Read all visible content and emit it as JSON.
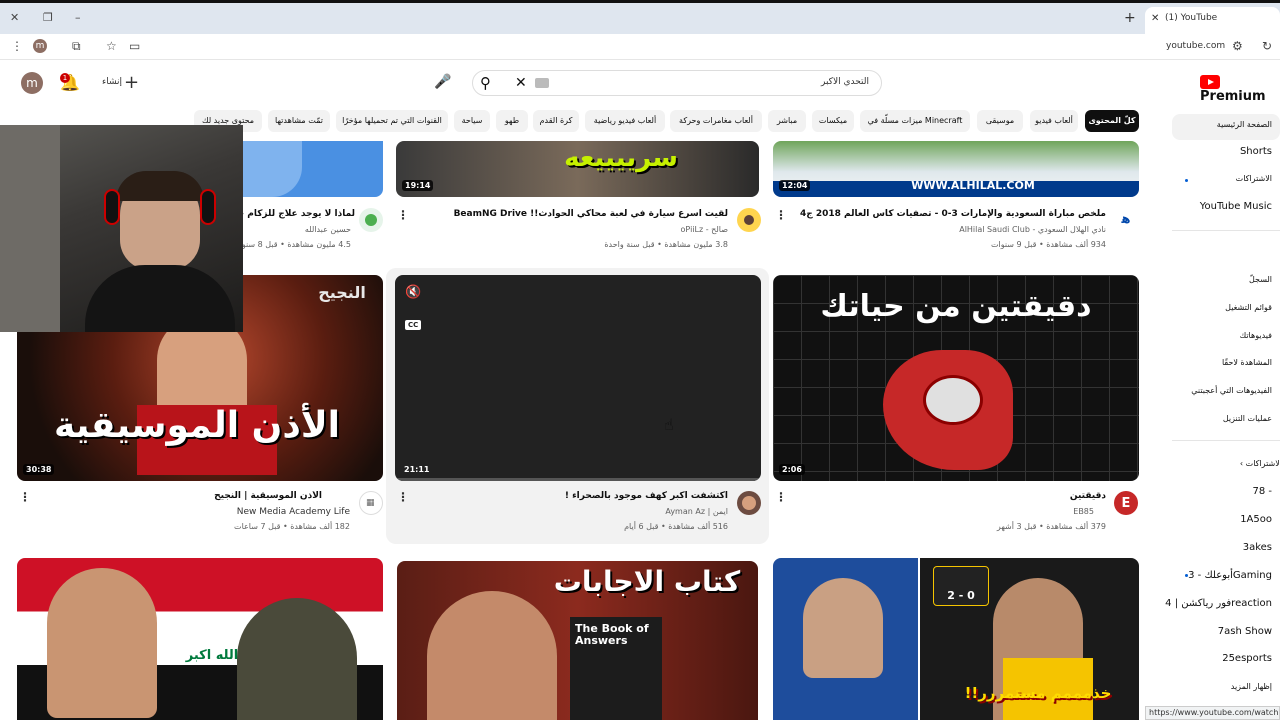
{
  "browser": {
    "tab_title": "(1) YouTube",
    "url": "youtube.com",
    "status_url": "https://www.youtube.com/watch?v"
  },
  "header": {
    "avatar_letter": "m",
    "notification_count": "1",
    "create_label": "إنشاء",
    "search_query": "التحدي الاكبر",
    "brand": "Premium"
  },
  "chips": [
    {
      "label": "كلّ المحتوى",
      "active": true
    },
    {
      "label": "ألعاب فيديو"
    },
    {
      "label": "موسيقى"
    },
    {
      "label": "ميزات مسلّة في Minecraft"
    },
    {
      "label": "ميكسات"
    },
    {
      "label": "مباشر"
    },
    {
      "label": "ألعاب مغامرات وحركة"
    },
    {
      "label": "ألعاب فيديو رياضية"
    },
    {
      "label": "كرة القدم"
    },
    {
      "label": "طهو"
    },
    {
      "label": "سياحة"
    },
    {
      "label": "القنوات التي تم تحميلها مؤخرًا"
    },
    {
      "label": "تمّت مشاهدتها"
    },
    {
      "label": "محتوى جديد لك"
    }
  ],
  "sidebar": {
    "main": [
      "الصفحة الرئيسية",
      "Shorts",
      "الاشتراكات",
      "YouTube Music"
    ],
    "you": [
      "السجلّ",
      "قوائم التشغيل",
      "فيديوهاتك",
      "المشاهدة لاحقًا",
      "الفيديوهات التي أعجبتني",
      "عمليات التنزيل"
    ],
    "subs_header": "الاشتراكات",
    "subs": [
      "78 -",
      "1A5oo",
      "3akes",
      "أبوعلك - 3Gaming",
      "فور رياكشن | 4reaction",
      "7ash Show",
      "25esports",
      "إظهار المزيد"
    ]
  },
  "videos": {
    "row1": [
      {
        "title": "لماذا لا يوجد علاج للزكام حتى",
        "channel": "حسين عبدالله",
        "meta": "4.5 مليون مشاهدة • قبل 8 سنوات"
      },
      {
        "title": "لقيت اسرع سيارة في لعبة محاكي الحوادث!! BeamNG Drive",
        "channel": "صالح - oPiiLz",
        "meta": "3.8 مليون مشاهدة • قبل سنة واحدة",
        "duration": "19:14",
        "overlay": "سرييييعه"
      },
      {
        "title": "ملخص مباراة السعودية والإمارات 3-0 - تصفيات كأس العالم 2018 ج4",
        "channel": "نادي الهلال السعودي - AlHilal Saudi Club",
        "meta": "934 ألف مشاهدة • قبل 9 سنوات",
        "duration": "12:04",
        "overlay": "WWW.ALHILAL.COM"
      }
    ],
    "row2": [
      {
        "title": "الأذن الموسيقية | النجيح",
        "channel": "New Media Academy Life",
        "meta": "182 ألف مشاهدة • قبل 7 ساعات",
        "duration": "30:38",
        "overlay": "الأذن الموسيقية",
        "logo": "النجيح"
      },
      {
        "title": "اكتشفت اكبر كهف موجود بالصحراء !",
        "channel": "ايمن | Ayman Az",
        "meta": "516 ألف مشاهدة • قبل 6 أيام",
        "duration": "21:11"
      },
      {
        "title": "دقيقتين",
        "channel": "EB85",
        "meta": "379 ألف مشاهدة • قبل 3 أشهر",
        "duration": "2:06",
        "overlay": "دقيقتين من حياتك"
      }
    ],
    "row3": [
      {
        "overlay": "الله اكبر"
      },
      {
        "overlay": "كتاب الاجابات",
        "book": "The Book of Answers"
      },
      {
        "overlay": "خذمممم مستمررر!!",
        "score": "2 - 0"
      }
    ]
  }
}
